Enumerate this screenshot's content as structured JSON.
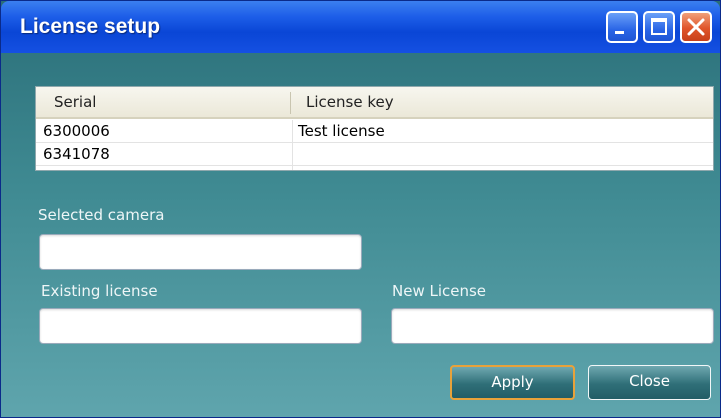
{
  "window": {
    "title": "License setup"
  },
  "table": {
    "headers": [
      "Serial",
      "License key"
    ],
    "rows": [
      {
        "serial": "6300006",
        "license_key": "Test license"
      },
      {
        "serial": "6341078",
        "license_key": ""
      }
    ]
  },
  "form": {
    "selected_camera_label": "Selected camera",
    "selected_camera_value": "",
    "existing_license_label": "Existing license",
    "existing_license_value": "",
    "new_license_label": "New License",
    "new_license_value": ""
  },
  "buttons": {
    "apply": "Apply",
    "close": "Close"
  },
  "icons": {
    "minimize": "minimize-icon",
    "maximize": "maximize-icon",
    "close": "close-icon"
  },
  "colors": {
    "titlebar": "#0a46d6",
    "background": "#2f6f78",
    "apply_border": "#e8a23a"
  }
}
